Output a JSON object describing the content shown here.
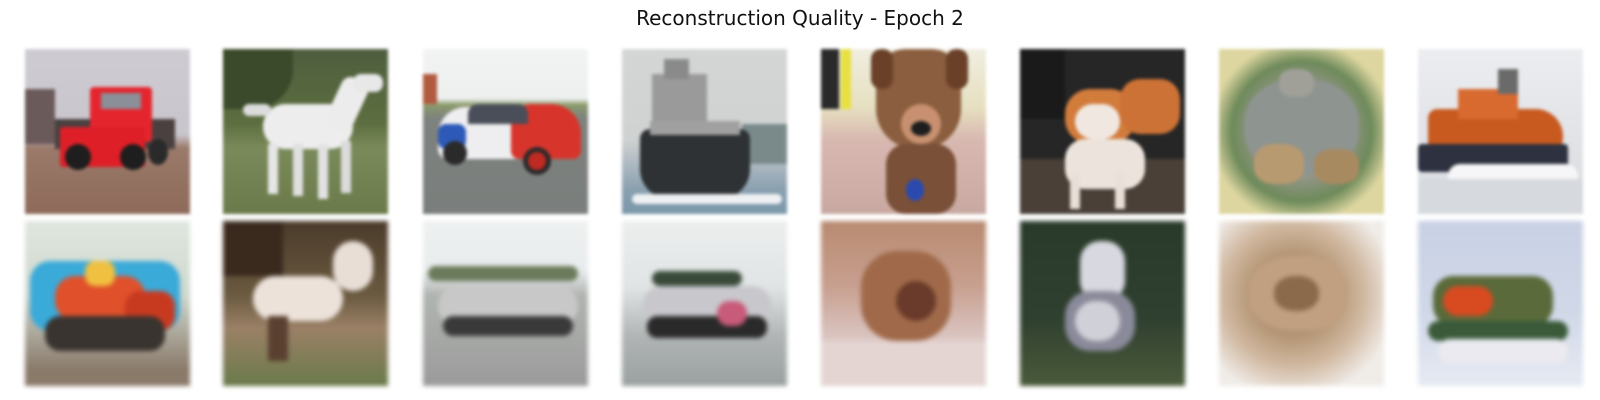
{
  "title": "Reconstruction Quality - Epoch 2",
  "rows": [
    {
      "name": "original-row",
      "images": [
        {
          "subject": "red truck",
          "palette": [
            "#c9c5cc",
            "#8a6a5a",
            "#e0202a",
            "#3a3a3a"
          ]
        },
        {
          "subject": "white horse",
          "palette": [
            "#4a5a3a",
            "#6b7a4a",
            "#eaeaea",
            "#8a8a7a"
          ]
        },
        {
          "subject": "red white and blue car",
          "palette": [
            "#eef0f0",
            "#7a7e7c",
            "#d83a30",
            "#2a5ab0"
          ]
        },
        {
          "subject": "ship",
          "palette": [
            "#d0d2d2",
            "#3a3e40",
            "#8aa0b0",
            "#7a7a7a"
          ]
        },
        {
          "subject": "dog",
          "palette": [
            "#d8b8b0",
            "#8a5a3a",
            "#c89070",
            "#2a2a2a"
          ]
        },
        {
          "subject": "cat",
          "palette": [
            "#2a2a2a",
            "#d07a3a",
            "#f0e8e0",
            "#5a4a3a"
          ]
        },
        {
          "subject": "frog",
          "palette": [
            "#ddd6a0",
            "#6e8a5a",
            "#9a9890",
            "#b8a070"
          ]
        },
        {
          "subject": "boat",
          "palette": [
            "#e8e8ec",
            "#c85a20",
            "#3a3e4a",
            "#f4f4f4"
          ]
        }
      ]
    },
    {
      "name": "reconstruction-row",
      "images": [
        {
          "subject": "truck reconstruction",
          "palette": [
            "#d8e0d8",
            "#e04a20",
            "#3aaad8",
            "#3a3a3a"
          ]
        },
        {
          "subject": "horse reconstruction",
          "palette": [
            "#5a4a3a",
            "#eae0d8",
            "#9a7a5a",
            "#6a7a4a"
          ]
        },
        {
          "subject": "car reconstruction",
          "palette": [
            "#e8ecec",
            "#9a9a9a",
            "#3a3a3a",
            "#6a7a5a"
          ]
        },
        {
          "subject": "ship reconstruction",
          "palette": [
            "#e8ecec",
            "#9aa0a0",
            "#2a2a2a",
            "#c85a7a"
          ]
        },
        {
          "subject": "dog reconstruction",
          "palette": [
            "#e0d0d0",
            "#a06a4a",
            "#6a3a2a",
            "#c8a090"
          ]
        },
        {
          "subject": "cat reconstruction",
          "palette": [
            "#2a3a2a",
            "#d8d8e0",
            "#4a5a3a",
            "#8a8a9a"
          ]
        },
        {
          "subject": "frog reconstruction",
          "palette": [
            "#f0ece8",
            "#b89a7a",
            "#8a6a4a",
            "#d0b8a0"
          ]
        },
        {
          "subject": "boat reconstruction",
          "palette": [
            "#d0d8e8",
            "#3a5a3a",
            "#d84a20",
            "#eaeaf0"
          ]
        }
      ]
    }
  ]
}
